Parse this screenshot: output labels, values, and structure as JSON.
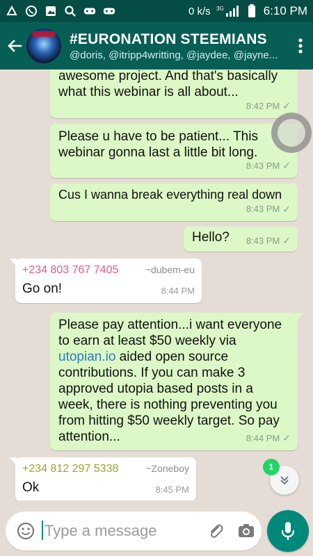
{
  "status_bar": {
    "left_icons": [
      "app-icon",
      "whatsapp-icon",
      "gallery-icon",
      "search-icon",
      "game-icon",
      "game-icon-2"
    ],
    "speed": "0 k/s",
    "network": "3G",
    "time": "6:10 PM"
  },
  "header": {
    "title": "#EURONATION STEEMIANS",
    "subtitle": "@doris, @itripp4writting, @jaydee, @jayne..."
  },
  "messages": [
    {
      "type": "out",
      "text": "awesome project. And that's basically what this webinar is all about...",
      "time": "8:42 PM"
    },
    {
      "type": "out",
      "text": "Please u have to be patient... This webinar gonna last a little bit long.",
      "time": "8:43 PM"
    },
    {
      "type": "out",
      "text": "Cus I wanna break everything real down",
      "time": "8:43 PM"
    },
    {
      "type": "out",
      "text": "Hello?",
      "time": "8:43 PM"
    },
    {
      "type": "in",
      "sender_phone": "+234 803 767 7405",
      "sender_name": "~dubem-eu",
      "sender_color": "#e05a8c",
      "text": "Go on!",
      "time": "8:44 PM"
    },
    {
      "type": "out",
      "text_before": "Please pay attention...i want everyone to earn at least $50 weekly via ",
      "link": "utopian.io",
      "text_after": " aided open source contributions. If you can make 3 approved utopia based posts in a week, there is nothing preventing you from hitting $50 weekly target. So pay attention...",
      "time": "8:44 PM"
    },
    {
      "type": "in",
      "sender_phone": "+234 812 297 5338",
      "sender_name": "~Zoneboy",
      "sender_color": "#9aa52a",
      "text": "Ok",
      "time": "8:45 PM"
    }
  ],
  "unread_count": "1",
  "composer": {
    "placeholder": "Type a message"
  },
  "colors": {
    "header": "#075e54",
    "status_bar": "#054d44",
    "outgoing": "#dcf8c6",
    "incoming": "#ffffff",
    "accent": "#00897b"
  }
}
